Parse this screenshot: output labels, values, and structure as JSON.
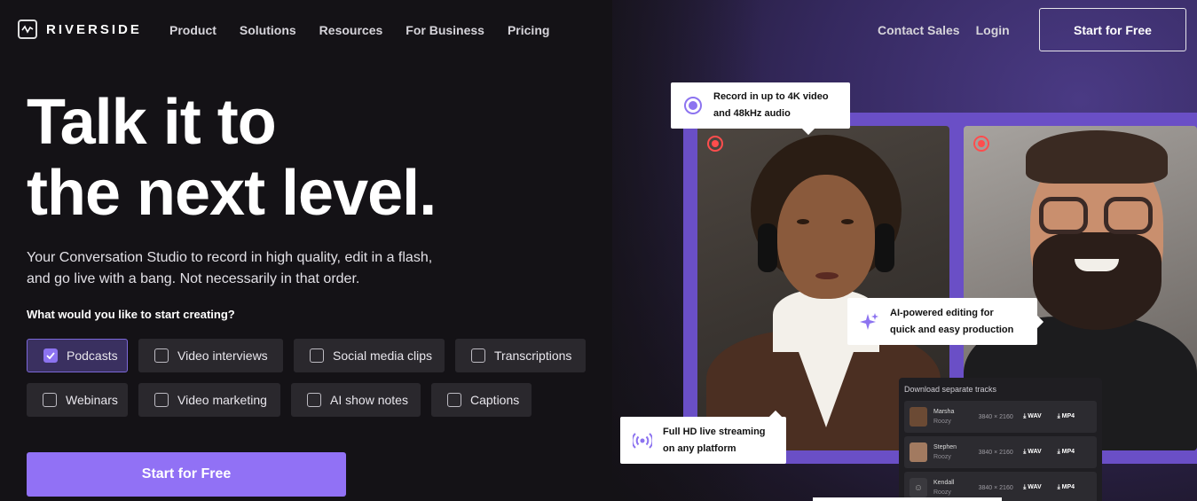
{
  "nav": {
    "logo_text": "RIVERSIDE",
    "links": [
      "Product",
      "Solutions",
      "Resources",
      "For Business",
      "Pricing"
    ],
    "contact_sales": "Contact Sales",
    "login": "Login",
    "cta": "Start for Free"
  },
  "hero": {
    "title_line1": "Talk it to",
    "title_line2": "the next level.",
    "subtitle": "Your Conversation Studio to record in high quality, edit in a flash, and go live with a bang. Not necessarily in that order.",
    "question": "What would you like to start creating?",
    "options": [
      {
        "label": "Podcasts",
        "checked": true
      },
      {
        "label": "Video interviews",
        "checked": false
      },
      {
        "label": "Social media clips",
        "checked": false
      },
      {
        "label": "Transcriptions",
        "checked": false
      },
      {
        "label": "Webinars",
        "checked": false
      },
      {
        "label": "Video marketing",
        "checked": false
      },
      {
        "label": "AI show notes",
        "checked": false
      },
      {
        "label": "Captions",
        "checked": false
      }
    ],
    "cta": "Start for Free"
  },
  "cards": {
    "record_line1": "Record in up to 4K video",
    "record_line2": "and 48kHz audio",
    "ai_line1": "AI-powered editing for",
    "ai_line2": "quick and easy production",
    "live_line1": "Full HD live streaming",
    "live_line2": "on any platform"
  },
  "download_panel": {
    "title": "Download separate tracks",
    "tracks": [
      {
        "name": "Marsha",
        "sub": "Roozy",
        "resolution": "3840 × 2160",
        "wav": "WAV",
        "mp4": "MP4"
      },
      {
        "name": "Stephen",
        "sub": "Roozy",
        "resolution": "3840 × 2160",
        "wav": "WAV",
        "mp4": "MP4"
      },
      {
        "name": "Kendall",
        "sub": "Roozy",
        "resolution": "3840 × 2160",
        "wav": "WAV",
        "mp4": "MP4"
      }
    ]
  },
  "colors": {
    "accent": "#9171f5",
    "background": "#141216",
    "frame": "#6a4fc6",
    "record": "#ff4d4d"
  }
}
